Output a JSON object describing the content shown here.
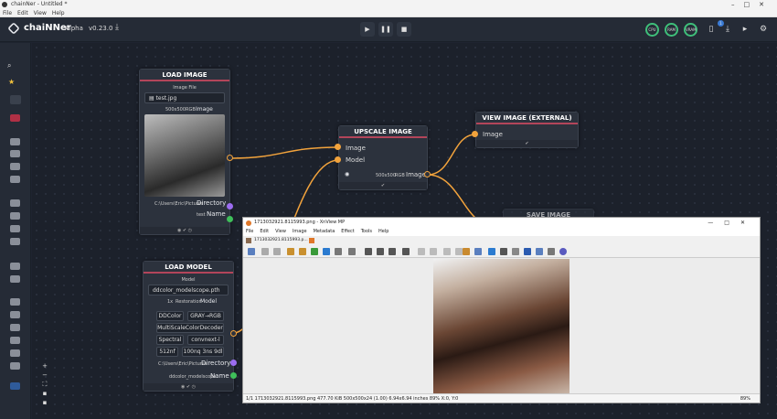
{
  "os": {
    "title": "chainNer - Untitled *",
    "menu": [
      "File",
      "Edit",
      "View",
      "Help"
    ]
  },
  "header": {
    "app_name": "chaiNNer",
    "channel": "Alpha",
    "version": "v0.23.0",
    "gauges": [
      "CPU",
      "RAM",
      "VRAM"
    ],
    "notif_count": "1"
  },
  "nodes": {
    "load_image": {
      "title": "LOAD IMAGE",
      "field_label": "Image File",
      "file": "test.jpg",
      "dims": "500x500",
      "mode": "RGB",
      "out_image": "Image",
      "dir_path": "C:\\Users\\Eric\\Pictures",
      "out_dir": "Directory",
      "name_val": "test",
      "out_name": "Name"
    },
    "upscale": {
      "title": "UPSCALE IMAGE",
      "in_image": "Image",
      "in_model": "Model",
      "dims": "500x500",
      "mode": "RGB",
      "out_image": "Image"
    },
    "view_ext": {
      "title": "VIEW IMAGE (EXTERNAL)",
      "in_image": "Image"
    },
    "save_image": {
      "title": "SAVE IMAGE"
    },
    "load_model": {
      "title": "LOAD MODEL",
      "field_label": "Model",
      "file": "ddcolor_modelscope.pth",
      "scale": "1x",
      "type": "Restoration",
      "out_model": "Model",
      "chips": [
        "DDColor",
        "GRAY→RGB",
        "MultiScaleColorDecoder",
        "Spectral",
        "convnext-l",
        "512nf",
        "100nq 3ns 9dl"
      ],
      "dir_path": "C:\\Users\\Eric\\Pictures",
      "out_dir": "Directory",
      "name_val": "ddcolor_modelscope",
      "out_name": "Name"
    }
  },
  "xnview": {
    "title": "1713032921.8115993.png - XnView MP",
    "menu": [
      "File",
      "Edit",
      "View",
      "Image",
      "Metadata",
      "Effect",
      "Tools",
      "Help"
    ],
    "tab": "1713032921.8115993.p...",
    "status": "1/1   1713032921.8115993.png   477.70 KiB   500x500x24 (1.00)   6.94x6.94 inches   89%   X:0, Y:0",
    "zoom": "89%"
  },
  "colors": {
    "accent_red": "#b3455a",
    "port_orange": "#f2a33c",
    "dir_purple": "#9b6cf0",
    "name_green": "#3fbf5a"
  }
}
